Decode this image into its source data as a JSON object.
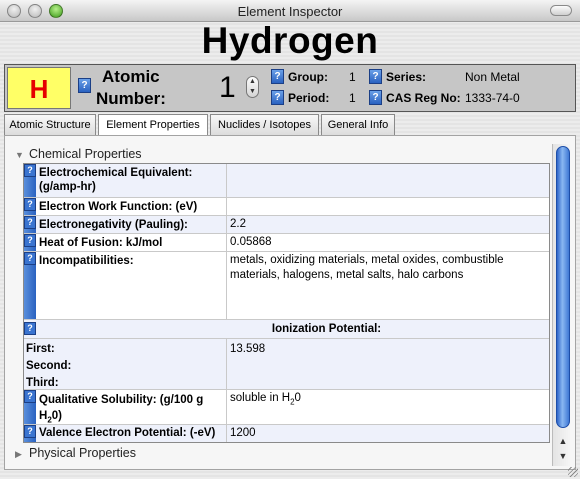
{
  "window": {
    "title": "Element Inspector"
  },
  "element": {
    "name": "Hydrogen",
    "symbol": "H",
    "atomic_number_label": [
      "Atomic",
      "Number:"
    ],
    "atomic_number": "1"
  },
  "properties": {
    "group_label": "Group:",
    "group": "1",
    "period_label": "Period:",
    "period": "1",
    "series_label": "Series:",
    "series": "Non Metal",
    "cas_label": "CAS Reg No:",
    "cas": "1333-74-0"
  },
  "help_glyph": "?",
  "tabs": [
    {
      "label": "Atomic Structure",
      "active": false
    },
    {
      "label": "Element Properties",
      "active": true
    },
    {
      "label": "Nuclides / Isotopes",
      "active": false
    },
    {
      "label": "General Info",
      "active": false
    }
  ],
  "sections": {
    "chemical": "Chemical Properties",
    "physical": "Physical Properties"
  },
  "chemical_rows": {
    "electrochemical_equivalent": {
      "label": [
        "Electrochemical Equivalent:",
        "(g/amp-hr)"
      ],
      "value": ""
    },
    "electron_work_function": {
      "label": "Electron Work Function: (eV)",
      "value": ""
    },
    "electronegativity": {
      "label": "Electronegativity (Pauling):",
      "value": "2.2"
    },
    "heat_of_fusion": {
      "label": "Heat of Fusion: kJ/mol",
      "value": "0.05868"
    },
    "incompatibilities": {
      "label": "Incompatibilities:",
      "value": "metals, oxidizing materials, metal oxides, combustible materials, halogens, metal salts, halo carbons"
    },
    "ionization_header": "Ionization Potential:",
    "ionization": {
      "first_label": "First:",
      "second_label": "Second:",
      "third_label": "Third:",
      "first": "13.598",
      "second": "",
      "third": ""
    },
    "solubility": {
      "label_a": "Qualitative Solubility: (g/100 g",
      "label_b_pre": "H",
      "label_b_sub": "2",
      "label_b_post": "0)",
      "value_pre": "soluble in H",
      "value_sub": "2",
      "value_post": "0"
    },
    "valence_electron_potential": {
      "label": "Valence Electron Potential: (-eV)",
      "value": "1200"
    }
  },
  "colors": {
    "accent": "#2a62c0",
    "symbol_bg": "#ffff66",
    "symbol_text": "#e60000",
    "info_bar": "#c6c6c6"
  }
}
